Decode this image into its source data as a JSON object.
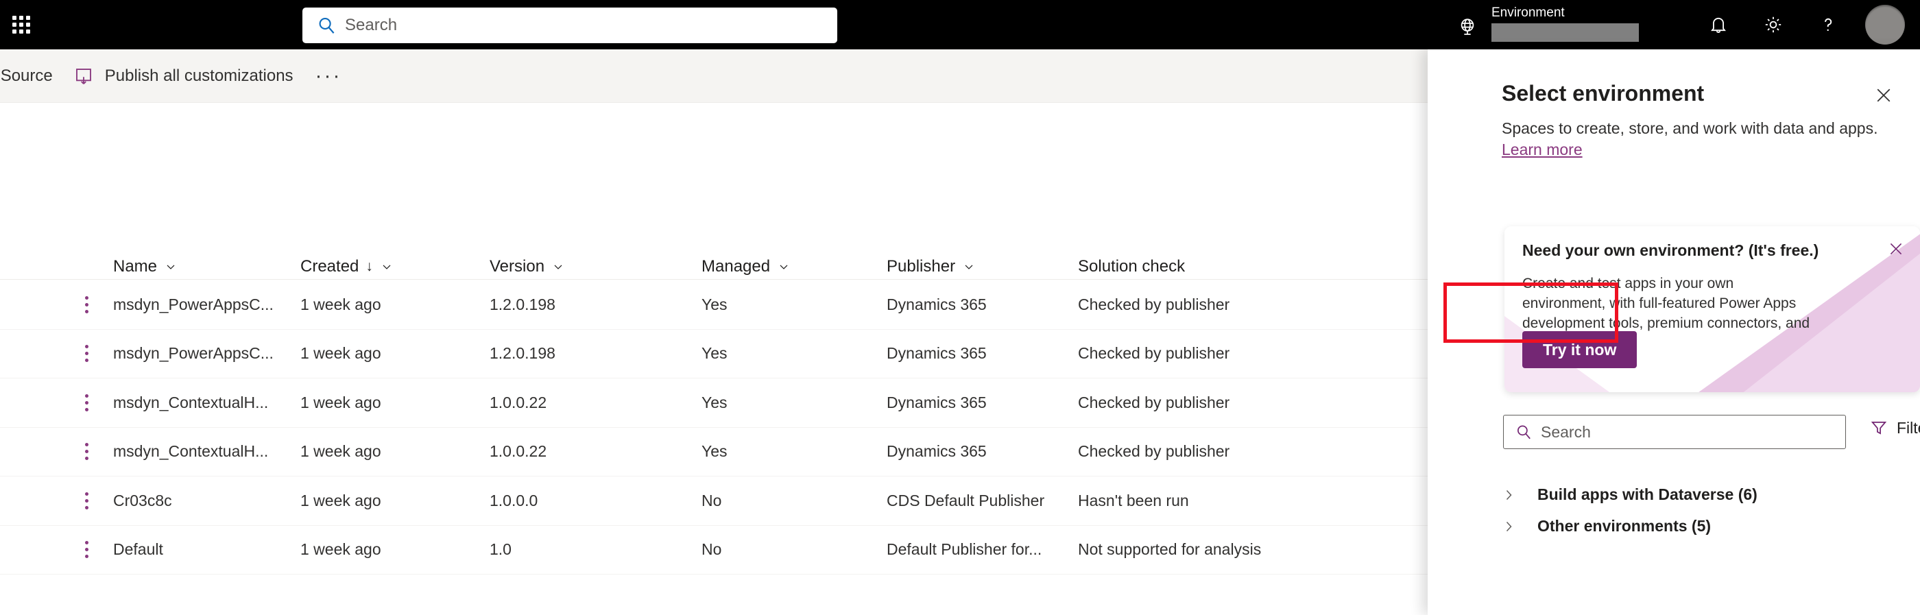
{
  "colors": {
    "header_bg": "#000000",
    "accent_purple": "#742774",
    "link_purple": "#8a3a80",
    "highlight_red": "#ee1122",
    "command_bar_bg": "#f5f4f2"
  },
  "header": {
    "search_placeholder": "Search",
    "environment_label": "Environment",
    "environment_value": "",
    "icons": {
      "waffle": "waffle-icon",
      "globe": "globe-icon",
      "bell": "notifications-bell-icon",
      "gear": "settings-gear-icon",
      "help": "help-question-icon",
      "avatar": "user-avatar"
    }
  },
  "command_bar": {
    "appsource_label": "AppSource",
    "publish_label": "Publish all customizations",
    "overflow_label": "···"
  },
  "table": {
    "columns": [
      {
        "key": "name",
        "label": "Name",
        "sortable": true,
        "sorted": false
      },
      {
        "key": "created",
        "label": "Created",
        "sortable": true,
        "sorted": true,
        "sort_direction": "desc"
      },
      {
        "key": "version",
        "label": "Version",
        "sortable": true,
        "sorted": false
      },
      {
        "key": "managed",
        "label": "Managed",
        "sortable": true,
        "sorted": false
      },
      {
        "key": "publisher",
        "label": "Publisher",
        "sortable": true,
        "sorted": false
      },
      {
        "key": "solution_check",
        "label": "Solution check",
        "sortable": false,
        "sorted": false
      }
    ],
    "sort_indicator": "↓",
    "rows": [
      {
        "name": "msdyn_PowerAppsC...",
        "created": "1 week ago",
        "version": "1.2.0.198",
        "managed": "Yes",
        "publisher": "Dynamics 365",
        "solution_check": "Checked by publisher"
      },
      {
        "name": "msdyn_PowerAppsC...",
        "created": "1 week ago",
        "version": "1.2.0.198",
        "managed": "Yes",
        "publisher": "Dynamics 365",
        "solution_check": "Checked by publisher"
      },
      {
        "name": "msdyn_ContextualH...",
        "created": "1 week ago",
        "version": "1.0.0.22",
        "managed": "Yes",
        "publisher": "Dynamics 365",
        "solution_check": "Checked by publisher"
      },
      {
        "name": "msdyn_ContextualH...",
        "created": "1 week ago",
        "version": "1.0.0.22",
        "managed": "Yes",
        "publisher": "Dynamics 365",
        "solution_check": "Checked by publisher"
      },
      {
        "name": "Cr03c8c",
        "created": "1 week ago",
        "version": "1.0.0.0",
        "managed": "No",
        "publisher": "CDS Default Publisher",
        "solution_check": "Hasn't been run"
      },
      {
        "name": "Default",
        "created": "1 week ago",
        "version": "1.0",
        "managed": "No",
        "publisher": "Default Publisher for...",
        "solution_check": "Not supported for analysis"
      }
    ]
  },
  "panel": {
    "title": "Select environment",
    "subtitle": "Spaces to create, store, and work with data and apps.",
    "learn_more": "Learn more",
    "close_label": "✕",
    "callout": {
      "title": "Need your own environment? (It's free.)",
      "body": "Create and test apps in your own environment, with full-featured Power Apps development tools, premium connectors, and Dataverse.",
      "button_label": "Try it now",
      "close_label": "✕"
    },
    "search_placeholder": "Search",
    "filter_label": "Filter",
    "groups": [
      {
        "label": "Build apps with Dataverse (6)",
        "count": 6,
        "expanded": false
      },
      {
        "label": "Other environments (5)",
        "count": 5,
        "expanded": false
      }
    ]
  }
}
